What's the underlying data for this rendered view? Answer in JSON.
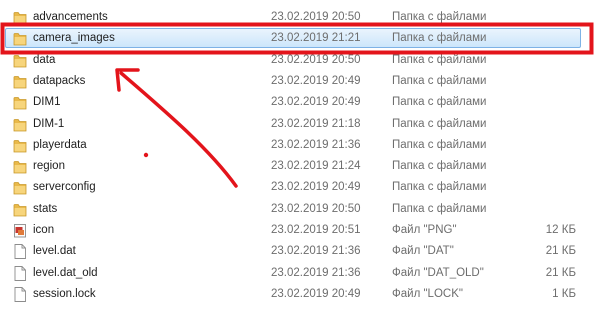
{
  "files": [
    {
      "name": "advancements",
      "date": "23.02.2019 20:50",
      "type": "Папка с файлами",
      "size": "",
      "icon": "folder-icon"
    },
    {
      "name": "camera_images",
      "date": "23.02.2019 21:21",
      "type": "Папка с файлами",
      "size": "",
      "icon": "folder-icon",
      "selected": true
    },
    {
      "name": "data",
      "date": "23.02.2019 20:50",
      "type": "Папка с файлами",
      "size": "",
      "icon": "folder-icon"
    },
    {
      "name": "datapacks",
      "date": "23.02.2019 20:49",
      "type": "Папка с файлами",
      "size": "",
      "icon": "folder-icon"
    },
    {
      "name": "DIM1",
      "date": "23.02.2019 20:49",
      "type": "Папка с файлами",
      "size": "",
      "icon": "folder-icon"
    },
    {
      "name": "DIM-1",
      "date": "23.02.2019 21:18",
      "type": "Папка с файлами",
      "size": "",
      "icon": "folder-icon"
    },
    {
      "name": "playerdata",
      "date": "23.02.2019 21:36",
      "type": "Папка с файлами",
      "size": "",
      "icon": "folder-icon"
    },
    {
      "name": "region",
      "date": "23.02.2019 21:24",
      "type": "Папка с файлами",
      "size": "",
      "icon": "folder-icon"
    },
    {
      "name": "serverconfig",
      "date": "23.02.2019 20:49",
      "type": "Папка с файлами",
      "size": "",
      "icon": "folder-icon"
    },
    {
      "name": "stats",
      "date": "23.02.2019 20:50",
      "type": "Папка с файлами",
      "size": "",
      "icon": "folder-icon"
    },
    {
      "name": "icon",
      "date": "23.02.2019 20:51",
      "type": "Файл \"PNG\"",
      "size": "12 КБ",
      "icon": "image-file-icon"
    },
    {
      "name": "level.dat",
      "date": "23.02.2019 21:36",
      "type": "Файл \"DAT\"",
      "size": "21 КБ",
      "icon": "file-icon"
    },
    {
      "name": "level.dat_old",
      "date": "23.02.2019 21:36",
      "type": "Файл \"DAT_OLD\"",
      "size": "21 КБ",
      "icon": "file-icon"
    },
    {
      "name": "session.lock",
      "date": "23.02.2019 20:49",
      "type": "Файл \"LOCK\"",
      "size": "1 КБ",
      "icon": "file-icon"
    }
  ],
  "annotation": {
    "color": "#e3141b"
  }
}
